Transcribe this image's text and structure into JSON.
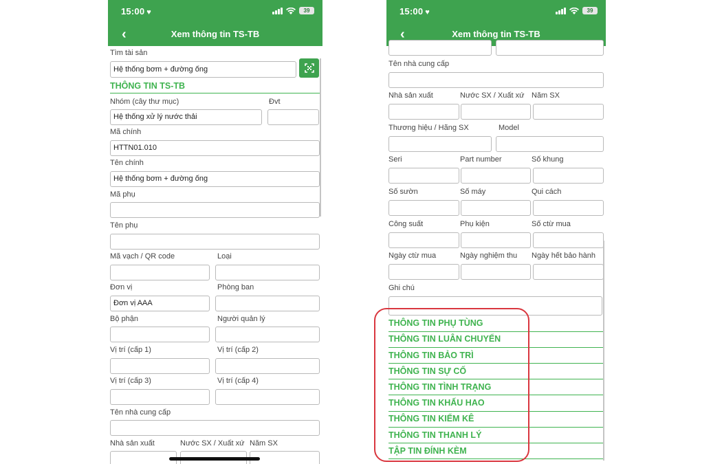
{
  "status_bar": {
    "time": "15:00",
    "battery": "39"
  },
  "navbar": {
    "title": "Xem thông tin TS-TB"
  },
  "left": {
    "search_label": "Tìm tài sản",
    "search_value": "Hệ thống bơm + đường ống",
    "section_title": "THÔNG TIN TS-TB",
    "group_label": "Nhóm (cây thư mục)",
    "group_value": "Hệ thống xử lý nước thải",
    "unit_label": "Đvt",
    "main_code_label": "Mã chính",
    "main_code_value": "HTTN01.010",
    "main_name_label": "Tên chính",
    "main_name_value": "Hệ thống bơm + đường ống",
    "sub_code_label": "Mã phụ",
    "sub_name_label": "Tên phụ",
    "barcode_label": "Mã vạch / QR code",
    "type_label": "Loại",
    "org_label": "Đơn vị",
    "org_value": "Đơn vị AAA",
    "room_label": "Phòng ban",
    "dept_label": "Bộ phận",
    "manager_label": "Người quản lý",
    "loc1_label": "Vị trí (cấp 1)",
    "loc2_label": "Vị trí (cấp 2)",
    "loc3_label": "Vị trí (cấp 3)",
    "loc4_label": "Vị trí (cấp 4)",
    "supplier_label": "Tên nhà cung cấp",
    "manufacturer_label": "Nhà sản xuất",
    "origin_label": "Nước SX / Xuất xứ",
    "year_label": "Năm SX"
  },
  "right": {
    "supplier_label": "Tên nhà cung cấp",
    "manufacturer_label": "Nhà sản xuất",
    "origin_label": "Nước SX / Xuất xứ",
    "year_label": "Năm SX",
    "brand_label": "Thương hiệu / Hãng SX",
    "model_label": "Model",
    "serial_label": "Seri",
    "part_label": "Part number",
    "frame_label": "Số khung",
    "rib_label": "Số sườn",
    "engine_label": "Số máy",
    "spec_label": "Qui cách",
    "power_label": "Công suất",
    "accessory_label": "Phụ kiện",
    "voucher_label": "Số ctừ mua",
    "buy_date_label": "Ngày ctừ mua",
    "test_date_label": "Ngày nghiệm thu",
    "warranty_label": "Ngày hết bảo hành",
    "note_label": "Ghi chú",
    "sections": [
      "THÔNG TIN PHỤ TÙNG",
      "THÔNG TIN LUÂN CHUYỂN",
      "THÔNG TIN BẢO TRÌ",
      "THÔNG TIN SỰ CỐ",
      "THÔNG TIN TÌNH TRẠNG",
      "THÔNG TIN KHẤU HAO",
      "THÔNG TIN KIỂM KÊ",
      "THÔNG TIN THANH LÝ",
      "TẬP TIN ĐÍNH KÈM"
    ]
  },
  "colors": {
    "brand_green": "#3ea34f",
    "section_green": "#3fb34f",
    "highlight_red": "#d9363e"
  }
}
